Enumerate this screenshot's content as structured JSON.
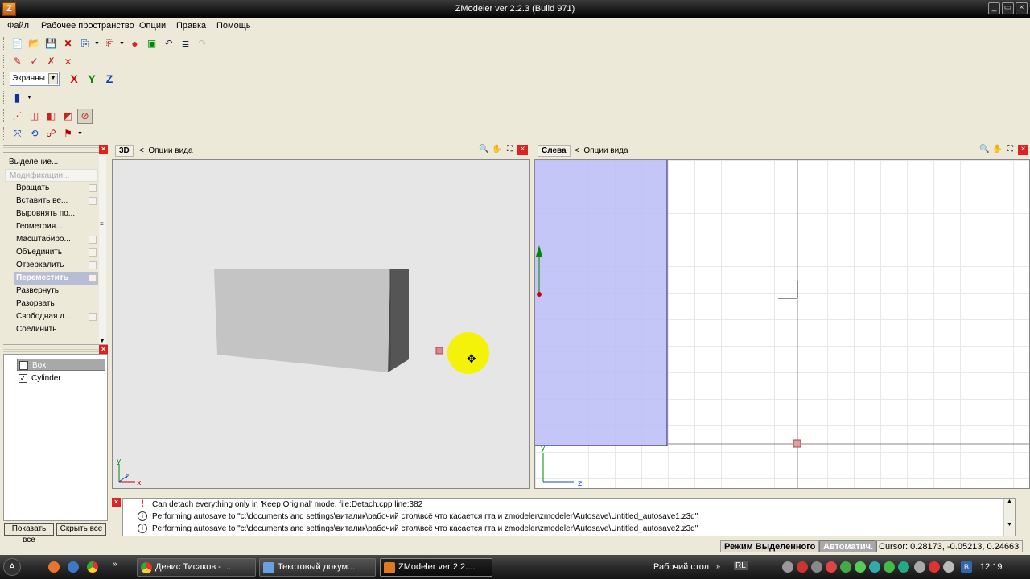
{
  "window": {
    "title": "ZModeler ver 2.2.3 (Build 971)",
    "icon": "zmodeler-icon"
  },
  "menu": [
    {
      "label": "Файл"
    },
    {
      "label": "Рабочее пространство"
    },
    {
      "label": "Опции"
    },
    {
      "label": "Правка"
    },
    {
      "label": "Помощь"
    }
  ],
  "toolbar": {
    "view_combo": "Экранны",
    "axes": {
      "x": "X",
      "y": "Y",
      "z": "Z"
    }
  },
  "commands": {
    "selection": "Выделение...",
    "modification": "Модификации...",
    "items": [
      {
        "label": "Вращать"
      },
      {
        "label": "Вставить ве..."
      },
      {
        "label": "Выровнять по..."
      },
      {
        "label": "Геометрия..."
      },
      {
        "label": "Масштабиро..."
      },
      {
        "label": "Объединить"
      },
      {
        "label": "Отзеркалить"
      },
      {
        "label": "Переместить"
      },
      {
        "label": "Развернуть"
      },
      {
        "label": "Разорвать"
      },
      {
        "label": "Свободная д..."
      },
      {
        "label": "Соединить"
      }
    ]
  },
  "objects": [
    {
      "name": "Box",
      "checked": true,
      "selected": true
    },
    {
      "name": "Cylinder",
      "checked": true,
      "selected": false
    }
  ],
  "object_buttons": {
    "show_all": "Показать все",
    "hide_all": "Скрыть все"
  },
  "viewport_3d": {
    "label": "3D",
    "options": "Опции вида",
    "axis_x": "x",
    "axis_y": "y",
    "axis_z": "z"
  },
  "viewport_left": {
    "label": "Слева",
    "options": "Опции вида",
    "axis_y": "y",
    "axis_z": "z"
  },
  "log": [
    {
      "type": "error",
      "text": "Can detach everything only in 'Keep Original' mode. file:Detach.cpp line:382"
    },
    {
      "type": "info",
      "text": "Performing autosave to \"c:\\documents and settings\\виталик\\рабочий стол\\всё что касается гта и zmodeler\\zmodeler\\Autosave\\Untitled_autosave1.z3d\""
    },
    {
      "type": "info",
      "text": "Performing autosave to \"c:\\documents and settings\\виталик\\рабочий стол\\всё что касается гта и zmodeler\\zmodeler\\Autosave\\Untitled_autosave2.z3d\""
    }
  ],
  "status": {
    "mode": "Режим Выделенного",
    "auto": "Автоматич.",
    "cursor": "Cursor: 0.28173, -0.05213, 0.24663"
  },
  "taskbar": {
    "start_label": "А",
    "tasks": [
      {
        "label": "Денис Тисаков - ..."
      },
      {
        "label": "Текстовый докум..."
      },
      {
        "label": "ZModeler ver 2.2...."
      }
    ],
    "desktop": "Рабочий стол",
    "lang": "RL",
    "clock": "12:19"
  },
  "colors": {
    "selection_fill": "#b8bcf5",
    "cursor_highlight": "#f5f20a",
    "taskbar": "#2a2a2a"
  }
}
